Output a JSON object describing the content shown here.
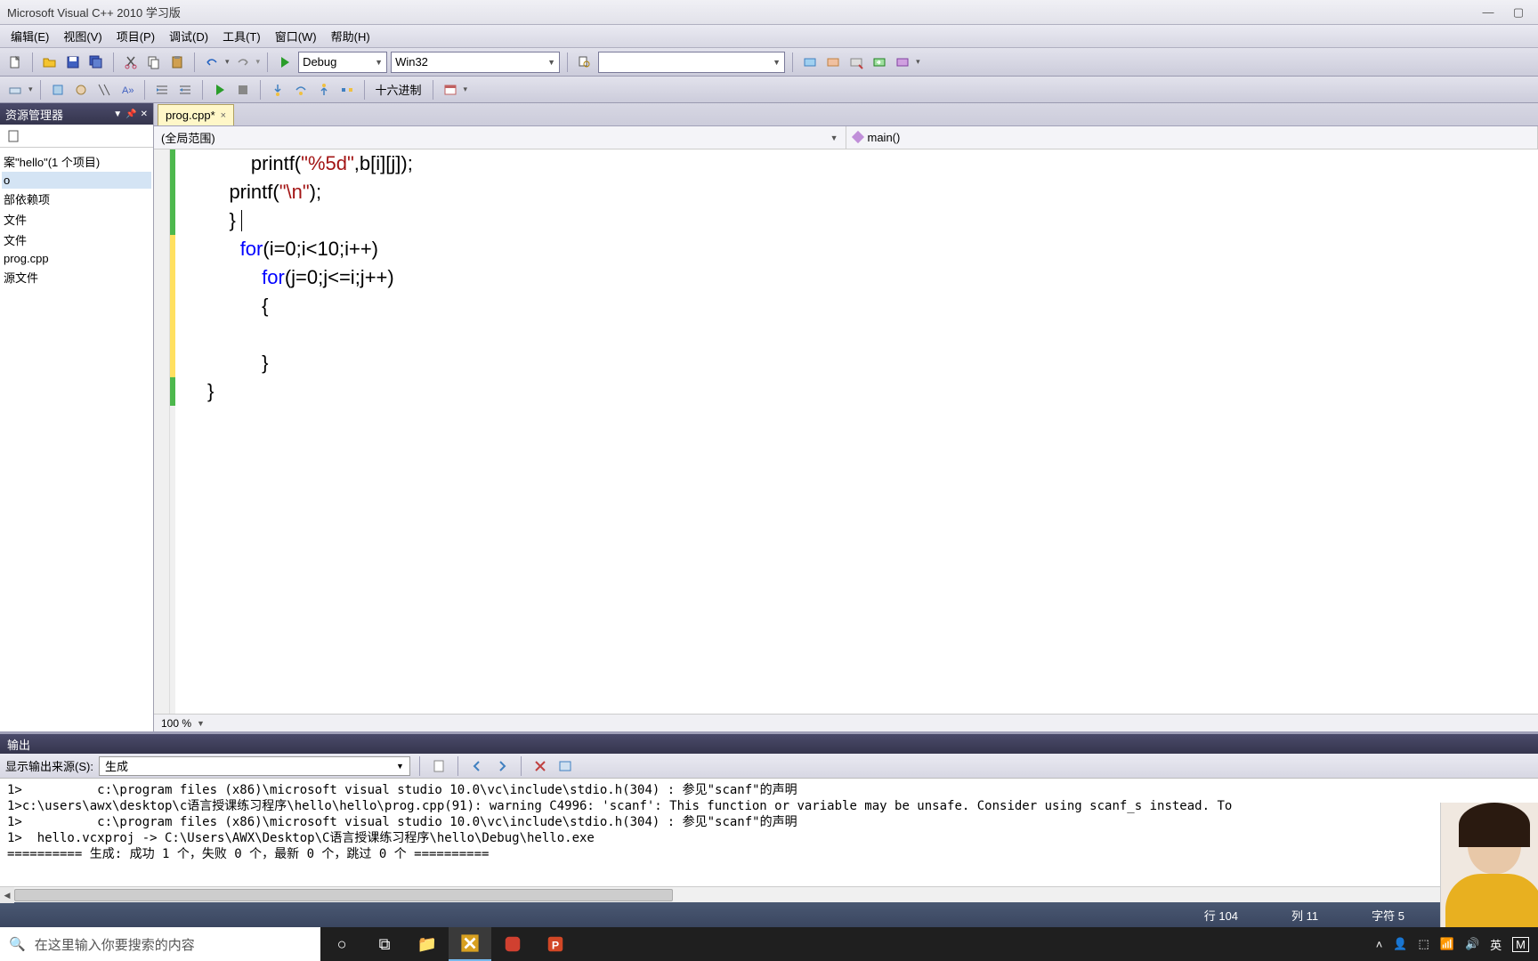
{
  "title": "Microsoft Visual C++ 2010 学习版",
  "menu": [
    "编辑(E)",
    "视图(V)",
    "项目(P)",
    "调试(D)",
    "工具(T)",
    "窗口(W)",
    "帮助(H)"
  ],
  "toolbar": {
    "config": "Debug",
    "platform": "Win32",
    "hex_label": "十六进制"
  },
  "sidebar": {
    "title": "资源管理器",
    "solution": "案\"hello\"(1 个项目)",
    "nodes": [
      "o",
      "部依赖项",
      "文件",
      "文件",
      "prog.cpp",
      "源文件"
    ]
  },
  "tab": {
    "name": "prog.cpp*",
    "close": "×"
  },
  "scope": {
    "left": "(全局范围)",
    "right": "main()"
  },
  "code": {
    "lines": [
      {
        "indent": 4,
        "text": "printf(\"%5d\",b[i][j]);",
        "mod": "green"
      },
      {
        "indent": 2,
        "text": "printf(\"\\n\");",
        "mod": "green"
      },
      {
        "indent": 2,
        "text": "}",
        "mod": "green",
        "caret": true
      },
      {
        "indent": 3,
        "text": "for(i=0;i<10;i++)",
        "kw": "for",
        "mod": "yellow"
      },
      {
        "indent": 5,
        "text": "for(j=0;j<=i;j++)",
        "kw": "for",
        "mod": "yellow"
      },
      {
        "indent": 5,
        "text": "{",
        "mod": "yellow"
      },
      {
        "indent": 5,
        "text": "",
        "mod": "yellow"
      },
      {
        "indent": 5,
        "text": "}",
        "mod": "yellow"
      },
      {
        "indent": 0,
        "text": "}",
        "mod": "green"
      }
    ]
  },
  "zoom": "100 %",
  "output": {
    "title": "输出",
    "from_label": "显示输出来源(S):",
    "from_value": "生成",
    "lines": [
      "1>          c:\\program files (x86)\\microsoft visual studio 10.0\\vc\\include\\stdio.h(304) : 参见\"scanf\"的声明",
      "1>c:\\users\\awx\\desktop\\c语言授课练习程序\\hello\\hello\\prog.cpp(91): warning C4996: 'scanf': This function or variable may be unsafe. Consider using scanf_s instead. To",
      "1>          c:\\program files (x86)\\microsoft visual studio 10.0\\vc\\include\\stdio.h(304) : 参见\"scanf\"的声明",
      "1>  hello.vcxproj -> C:\\Users\\AWX\\Desktop\\C语言授课练习程序\\hello\\Debug\\hello.exe",
      "========== 生成: 成功 1 个，失败 0 个，最新 0 个，跳过 0 个 =========="
    ]
  },
  "status": {
    "line": "行 104",
    "col": "列 11",
    "char": "字符 5"
  },
  "taskbar": {
    "search_placeholder": "在这里输入你要搜索的内容",
    "ime": "英",
    "ime2": "M"
  }
}
